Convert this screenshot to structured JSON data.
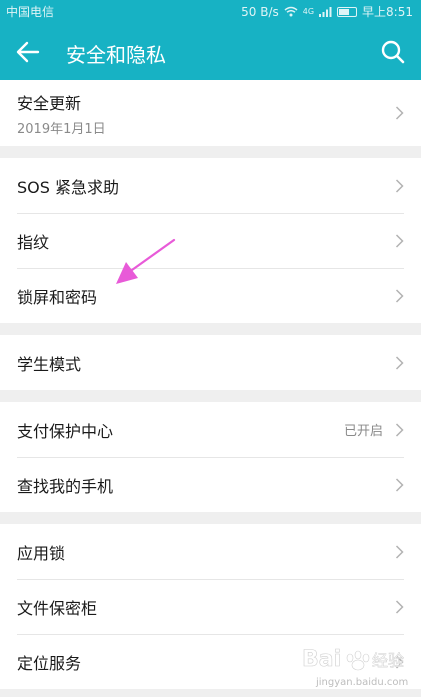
{
  "status_bar": {
    "carrier": "中国电信",
    "speed": "50 B/s",
    "signal": "4G",
    "time": "早上8:51",
    "battery_level": 0.55
  },
  "app_bar": {
    "title": "安全和隐私",
    "back_icon": "arrow-left-icon",
    "search_icon": "search-icon"
  },
  "groups": [
    {
      "items": [
        {
          "label": "安全更新",
          "sub": "2019年1月1日"
        }
      ]
    },
    {
      "items": [
        {
          "label": "SOS 紧急求助"
        },
        {
          "label": "指纹"
        },
        {
          "label": "锁屏和密码"
        }
      ]
    },
    {
      "items": [
        {
          "label": "学生模式"
        }
      ]
    },
    {
      "items": [
        {
          "label": "支付保护中心",
          "value": "已开启"
        },
        {
          "label": "查找我的手机"
        }
      ]
    },
    {
      "items": [
        {
          "label": "应用锁"
        },
        {
          "label": "文件保密柜"
        },
        {
          "label": "定位服务"
        }
      ]
    }
  ],
  "annotation": {
    "icon": "pink-arrow-icon",
    "color": "#e85ad8"
  },
  "watermark": {
    "brand": "Bai",
    "sub": "经验",
    "url": "jingyan.baidu.com"
  }
}
